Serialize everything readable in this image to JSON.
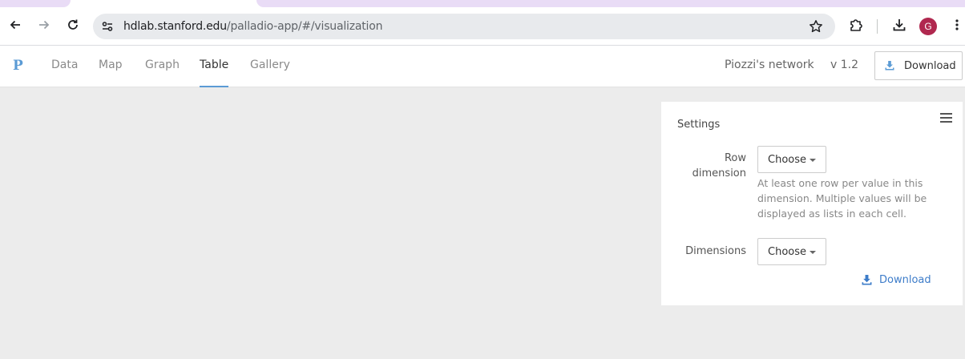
{
  "browser": {
    "url_host": "hdlab.stanford.edu",
    "url_path": "/palladio-app/#/visualization",
    "avatar_letter": "G",
    "accent_color": "#b0284f"
  },
  "app": {
    "logo": "P",
    "tabs": [
      {
        "label": "Data",
        "active": false
      },
      {
        "label": "Map",
        "active": false
      },
      {
        "label": "Graph",
        "active": false
      },
      {
        "label": "Table",
        "active": true
      },
      {
        "label": "Gallery",
        "active": false
      }
    ],
    "project_name": "Piozzi's network",
    "version": "v 1.2",
    "download_label": "Download",
    "accent_color": "#5b9bd5"
  },
  "settings": {
    "title": "Settings",
    "row_dimension_label": "Row dimension",
    "row_dimension_value": "Choose",
    "row_dimension_help": "At least one row per value in this dimension. Multiple values will be displayed as lists in each cell.",
    "dimensions_label": "Dimensions",
    "dimensions_value": "Choose",
    "download_label": "Download",
    "link_color": "#3d7cc9"
  }
}
